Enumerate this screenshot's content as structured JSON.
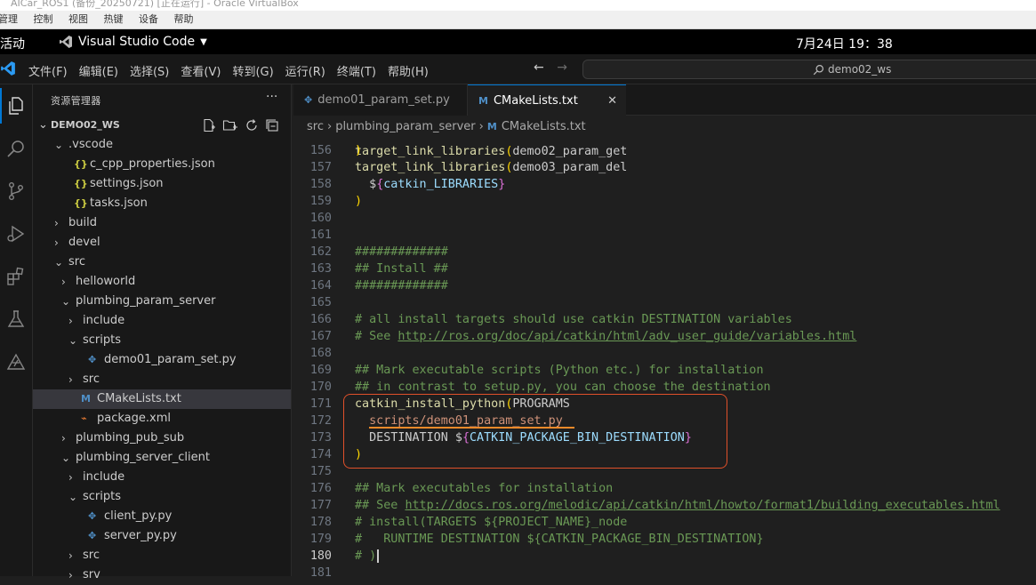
{
  "vbox": {
    "title": "AICar_ROS1 (备份_20250721) [正在运行] - Oracle VirtualBox",
    "menu": [
      "管理",
      "控制",
      "视图",
      "热键",
      "设备",
      "帮助"
    ]
  },
  "gnome": {
    "activities": "活动",
    "app_name": "Visual Studio Code",
    "clock": "7月24日  19：38"
  },
  "vscode": {
    "menu": [
      "文件(F)",
      "编辑(E)",
      "选择(S)",
      "查看(V)",
      "转到(G)",
      "运行(R)",
      "终端(T)",
      "帮助(H)"
    ],
    "search_text": "demo02_ws",
    "sidebar_title": "资源管理器",
    "workspace": "DEMO02_WS",
    "tree": [
      {
        "name": ".vscode",
        "depth": 1,
        "chevron": "open",
        "icon": ""
      },
      {
        "name": "c_cpp_properties.json",
        "depth": 2,
        "chevron": "",
        "icon": "{}"
      },
      {
        "name": "settings.json",
        "depth": 2,
        "chevron": "",
        "icon": "{}"
      },
      {
        "name": "tasks.json",
        "depth": 2,
        "chevron": "",
        "icon": "{}"
      },
      {
        "name": "build",
        "depth": 1,
        "chevron": "closed",
        "icon": ""
      },
      {
        "name": "devel",
        "depth": 1,
        "chevron": "closed",
        "icon": ""
      },
      {
        "name": "src",
        "depth": 1,
        "chevron": "open",
        "icon": ""
      },
      {
        "name": "helloworld",
        "depth": 2,
        "chevron": "closed",
        "icon": ""
      },
      {
        "name": "plumbing_param_server",
        "depth": 2,
        "chevron": "open",
        "icon": ""
      },
      {
        "name": "include",
        "depth": 3,
        "chevron": "closed",
        "icon": ""
      },
      {
        "name": "scripts",
        "depth": 3,
        "chevron": "open",
        "icon": ""
      },
      {
        "name": "demo01_param_set.py",
        "depth": 4,
        "chevron": "",
        "icon": "py"
      },
      {
        "name": "src",
        "depth": 3,
        "chevron": "closed",
        "icon": ""
      },
      {
        "name": "CMakeLists.txt",
        "depth": 3,
        "chevron": "",
        "icon": "M",
        "selected": true
      },
      {
        "name": "package.xml",
        "depth": 3,
        "chevron": "",
        "icon": "rss"
      },
      {
        "name": "plumbing_pub_sub",
        "depth": 2,
        "chevron": "closed",
        "icon": ""
      },
      {
        "name": "plumbing_server_client",
        "depth": 2,
        "chevron": "open",
        "icon": ""
      },
      {
        "name": "include",
        "depth": 3,
        "chevron": "closed",
        "icon": ""
      },
      {
        "name": "scripts",
        "depth": 3,
        "chevron": "open",
        "icon": ""
      },
      {
        "name": "client_py.py",
        "depth": 4,
        "chevron": "",
        "icon": "py"
      },
      {
        "name": "server_py.py",
        "depth": 4,
        "chevron": "",
        "icon": "py"
      },
      {
        "name": "src",
        "depth": 3,
        "chevron": "closed",
        "icon": ""
      },
      {
        "name": "srv",
        "depth": 3,
        "chevron": "closed",
        "icon": ""
      }
    ],
    "tabs": [
      {
        "label": "demo01_param_set.py",
        "active": false
      },
      {
        "label": "CMakeLists.txt",
        "active": true
      }
    ],
    "breadcrumb": [
      "src",
      "plumbing_param_server",
      "CMakeLists.txt"
    ],
    "current_line": 180,
    "lines": [
      {
        "n": 156,
        "text": ")"
      },
      {
        "n": 157,
        "text": "target_link_libraries(demo03_param_del"
      },
      {
        "n": 158,
        "text": "  ${catkin_LIBRARIES}"
      },
      {
        "n": 159,
        "text": ")"
      },
      {
        "n": 160,
        "text": ""
      },
      {
        "n": 161,
        "text": ""
      },
      {
        "n": 162,
        "text": "#############"
      },
      {
        "n": 163,
        "text": "## Install ##"
      },
      {
        "n": 164,
        "text": "#############"
      },
      {
        "n": 165,
        "text": ""
      },
      {
        "n": 166,
        "text": "# all install targets should use catkin DESTINATION variables"
      },
      {
        "n": 167,
        "text": "# See http://ros.org/doc/api/catkin/html/adv_user_guide/variables.html"
      },
      {
        "n": 168,
        "text": ""
      },
      {
        "n": 169,
        "text": "## Mark executable scripts (Python etc.) for installation"
      },
      {
        "n": 170,
        "text": "## in contrast to setup.py, you can choose the destination"
      },
      {
        "n": 171,
        "text": "catkin_install_python(PROGRAMS"
      },
      {
        "n": 172,
        "text": "  scripts/demo01_param_set.py"
      },
      {
        "n": 173,
        "text": "  DESTINATION ${CATKIN_PACKAGE_BIN_DESTINATION}"
      },
      {
        "n": 174,
        "text": ")"
      },
      {
        "n": 175,
        "text": ""
      },
      {
        "n": 176,
        "text": "## Mark executables for installation"
      },
      {
        "n": 177,
        "text": "## See http://docs.ros.org/melodic/api/catkin/html/howto/format1/building_executables.html"
      },
      {
        "n": 178,
        "text": "# install(TARGETS ${PROJECT_NAME}_node"
      },
      {
        "n": 179,
        "text": "#   RUNTIME DESTINATION ${CATKIN_PACKAGE_BIN_DESTINATION}"
      },
      {
        "n": 180,
        "text": "# )"
      },
      {
        "n": 181,
        "text": ""
      }
    ],
    "colors": {
      "accent": "#0078d4",
      "highlight_box": "#e0502a",
      "comment": "#6a9955"
    }
  }
}
